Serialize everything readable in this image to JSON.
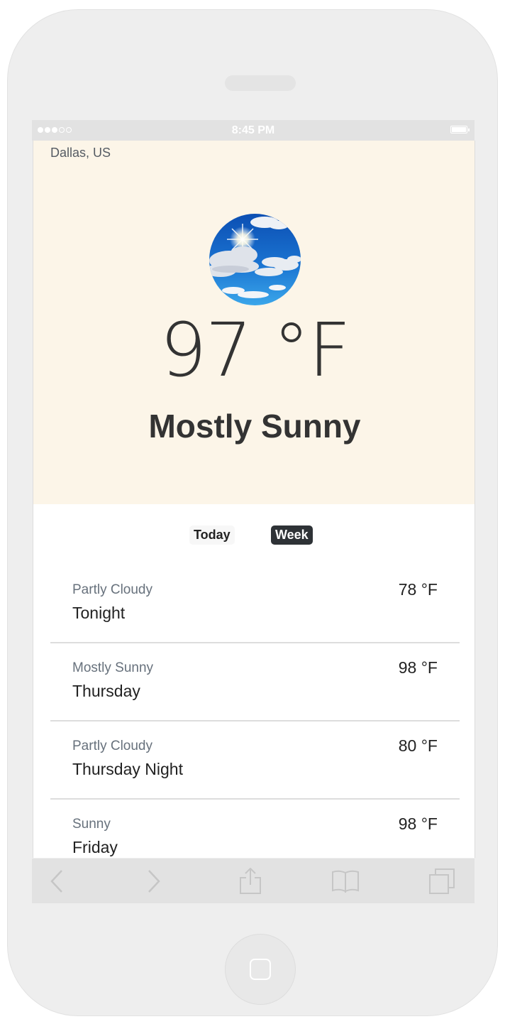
{
  "status_bar": {
    "time": "8:45 PM"
  },
  "weather": {
    "location": "Dallas, US",
    "current_temp": "97 °F",
    "condition": "Mostly Sunny",
    "image": "sun-with-clouds-icon"
  },
  "tabs": [
    {
      "label": "Today",
      "active": false
    },
    {
      "label": "Week",
      "active": true
    }
  ],
  "forecast": [
    {
      "condition": "Partly Cloudy",
      "period": "Tonight",
      "temp": "78 °F"
    },
    {
      "condition": "Mostly Sunny",
      "period": "Thursday",
      "temp": "98 °F"
    },
    {
      "condition": "Partly Cloudy",
      "period": "Thursday Night",
      "temp": "80 °F"
    },
    {
      "condition": "Sunny",
      "period": "Friday",
      "temp": "98 °F"
    }
  ],
  "toolbar": {
    "icons": [
      "back-icon",
      "forward-icon",
      "share-icon",
      "bookmarks-icon",
      "tabs-icon"
    ]
  },
  "colors": {
    "hero_background": "#fcf5e8",
    "active_tab": "#2e3236",
    "sky_blue": "#1a73d1"
  }
}
